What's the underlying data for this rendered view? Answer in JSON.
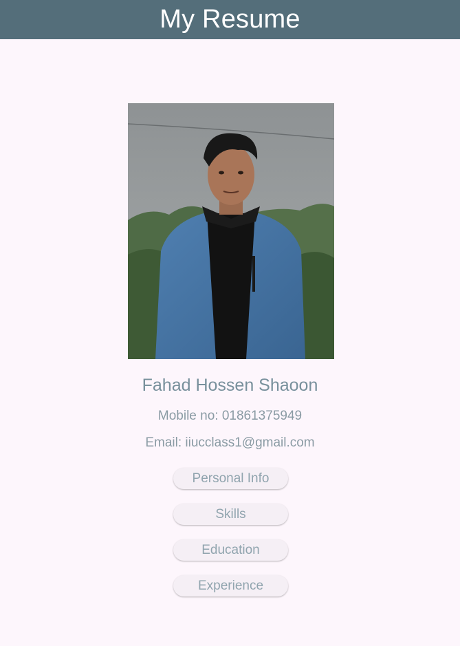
{
  "app_bar": {
    "title": "My Resume",
    "background_color": "#546e7a"
  },
  "profile": {
    "photo_description": "profile-photo",
    "name": "Fahad Hossen Shaoon",
    "mobile": "Mobile no: 01861375949",
    "email": "Email: iiucclass1@gmail.com"
  },
  "menu": {
    "buttons": [
      {
        "label": "Personal Info"
      },
      {
        "label": "Skills"
      },
      {
        "label": "Education"
      },
      {
        "label": "Experience"
      }
    ]
  },
  "colors": {
    "page_background": "#fdf6fc",
    "text_primary": "#78909c",
    "button_background": "#f5eff5"
  }
}
